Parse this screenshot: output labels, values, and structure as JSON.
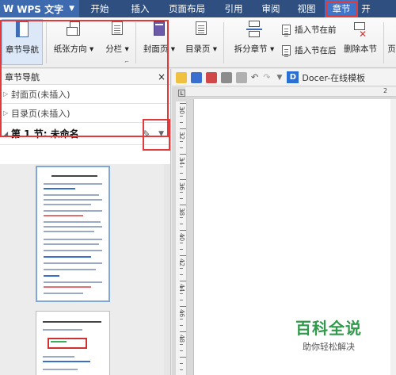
{
  "app": {
    "logo": "W",
    "name": "WPS 文字"
  },
  "menu": {
    "items": [
      "开始",
      "插入",
      "页面布局",
      "引用",
      "审阅",
      "视图",
      "章节",
      "开"
    ],
    "active": "章节"
  },
  "ribbon": {
    "chapter_nav": "章节导航",
    "paper_orient": "纸张方向",
    "columns": "分栏",
    "cover": "封面页",
    "toc": "目录页",
    "split_section": "拆分章节",
    "insert_before": "插入节在前",
    "insert_after": "插入节在后",
    "delete_section": "删除本节",
    "extra": "页"
  },
  "navpanel": {
    "title": "章节导航",
    "close": "×",
    "rows": [
      {
        "label": "封面页(未插入)"
      },
      {
        "label": "目录页(未插入)"
      }
    ],
    "section": "第 1 节: 未命名"
  },
  "toolbar2": {
    "docer": "Docer-在线模板",
    "docer_logo": "D"
  },
  "ruler": {
    "h_num": "2",
    "v_nums": [
      "30",
      "32",
      "34",
      "36",
      "38",
      "40",
      "42",
      "44",
      "46",
      "48"
    ]
  },
  "watermark": {
    "title": "百科全说",
    "subtitle": "助你轻松解决"
  }
}
